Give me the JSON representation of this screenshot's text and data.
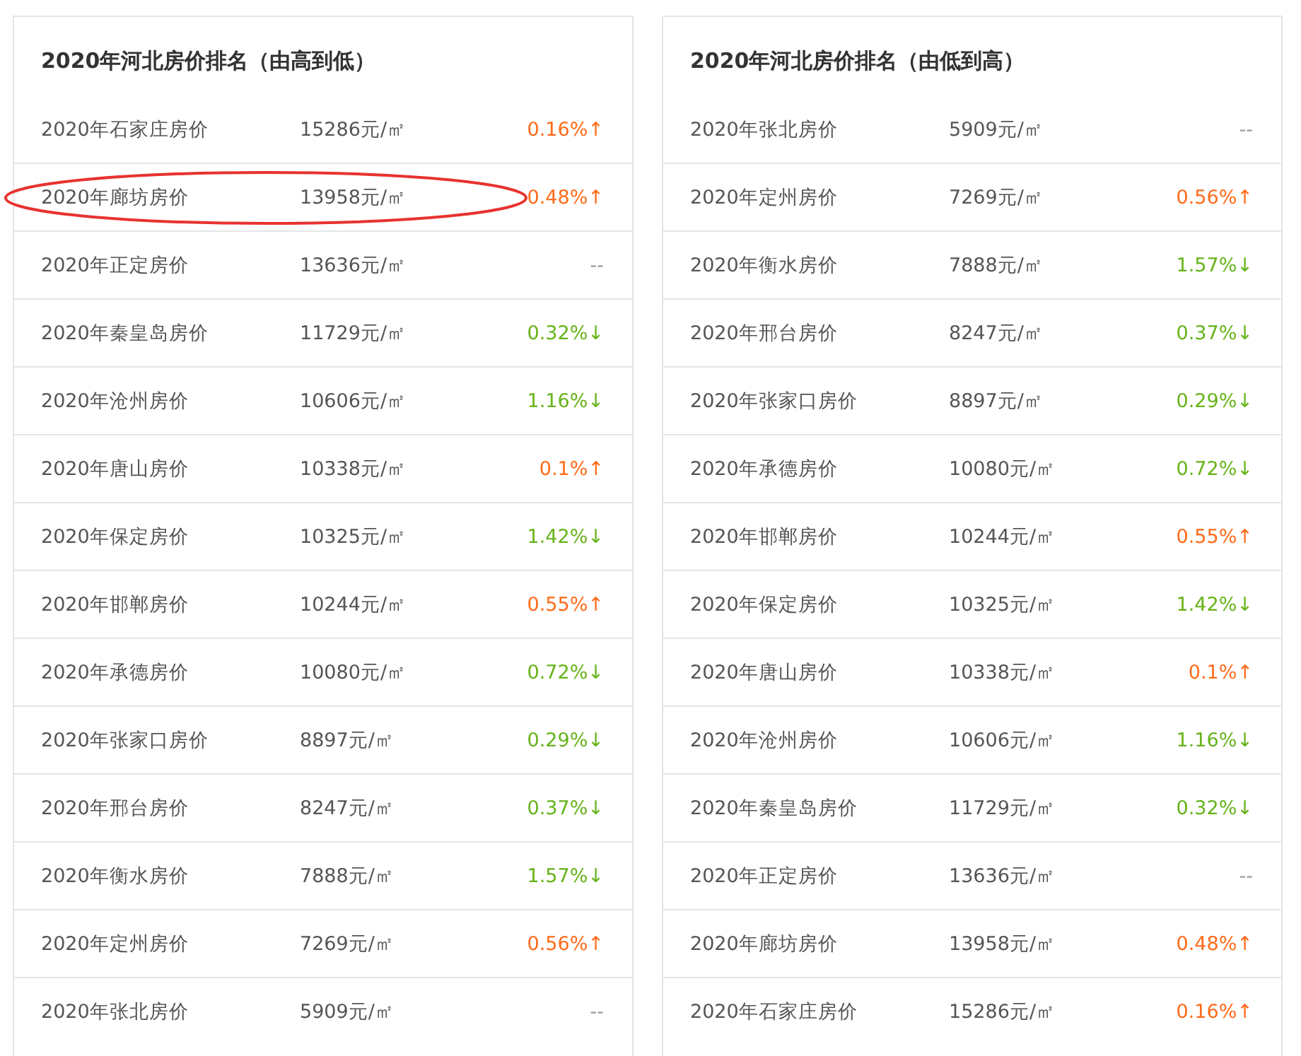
{
  "panels": [
    {
      "title": "2020年河北房价排名（由高到低）",
      "rows": [
        {
          "city": "2020年石家庄房价",
          "price": "15286元/㎡",
          "change": "0.16%↑",
          "kind": "up",
          "highlighted": false
        },
        {
          "city": "2020年廊坊房价",
          "price": "13958元/㎡",
          "change": "0.48%↑",
          "kind": "up",
          "highlighted": true
        },
        {
          "city": "2020年正定房价",
          "price": "13636元/㎡",
          "change": "--",
          "kind": "none",
          "highlighted": false
        },
        {
          "city": "2020年秦皇岛房价",
          "price": "11729元/㎡",
          "change": "0.32%↓",
          "kind": "down",
          "highlighted": false
        },
        {
          "city": "2020年沧州房价",
          "price": "10606元/㎡",
          "change": "1.16%↓",
          "kind": "down",
          "highlighted": false
        },
        {
          "city": "2020年唐山房价",
          "price": "10338元/㎡",
          "change": "0.1%↑",
          "kind": "up",
          "highlighted": false
        },
        {
          "city": "2020年保定房价",
          "price": "10325元/㎡",
          "change": "1.42%↓",
          "kind": "down",
          "highlighted": false
        },
        {
          "city": "2020年邯郸房价",
          "price": "10244元/㎡",
          "change": "0.55%↑",
          "kind": "up",
          "highlighted": false
        },
        {
          "city": "2020年承德房价",
          "price": "10080元/㎡",
          "change": "0.72%↓",
          "kind": "down",
          "highlighted": false
        },
        {
          "city": "2020年张家口房价",
          "price": "8897元/㎡",
          "change": "0.29%↓",
          "kind": "down",
          "highlighted": false
        },
        {
          "city": "2020年邢台房价",
          "price": "8247元/㎡",
          "change": "0.37%↓",
          "kind": "down",
          "highlighted": false
        },
        {
          "city": "2020年衡水房价",
          "price": "7888元/㎡",
          "change": "1.57%↓",
          "kind": "down",
          "highlighted": false
        },
        {
          "city": "2020年定州房价",
          "price": "7269元/㎡",
          "change": "0.56%↑",
          "kind": "up",
          "highlighted": false
        },
        {
          "city": "2020年张北房价",
          "price": "5909元/㎡",
          "change": "--",
          "kind": "none",
          "highlighted": false
        }
      ]
    },
    {
      "title": "2020年河北房价排名（由低到高）",
      "rows": [
        {
          "city": "2020年张北房价",
          "price": "5909元/㎡",
          "change": "--",
          "kind": "none",
          "highlighted": false
        },
        {
          "city": "2020年定州房价",
          "price": "7269元/㎡",
          "change": "0.56%↑",
          "kind": "up",
          "highlighted": false
        },
        {
          "city": "2020年衡水房价",
          "price": "7888元/㎡",
          "change": "1.57%↓",
          "kind": "down",
          "highlighted": false
        },
        {
          "city": "2020年邢台房价",
          "price": "8247元/㎡",
          "change": "0.37%↓",
          "kind": "down",
          "highlighted": false
        },
        {
          "city": "2020年张家口房价",
          "price": "8897元/㎡",
          "change": "0.29%↓",
          "kind": "down",
          "highlighted": false
        },
        {
          "city": "2020年承德房价",
          "price": "10080元/㎡",
          "change": "0.72%↓",
          "kind": "down",
          "highlighted": false
        },
        {
          "city": "2020年邯郸房价",
          "price": "10244元/㎡",
          "change": "0.55%↑",
          "kind": "up",
          "highlighted": false
        },
        {
          "city": "2020年保定房价",
          "price": "10325元/㎡",
          "change": "1.42%↓",
          "kind": "down",
          "highlighted": false
        },
        {
          "city": "2020年唐山房价",
          "price": "10338元/㎡",
          "change": "0.1%↑",
          "kind": "up",
          "highlighted": false
        },
        {
          "city": "2020年沧州房价",
          "price": "10606元/㎡",
          "change": "1.16%↓",
          "kind": "down",
          "highlighted": false
        },
        {
          "city": "2020年秦皇岛房价",
          "price": "11729元/㎡",
          "change": "0.32%↓",
          "kind": "down",
          "highlighted": false
        },
        {
          "city": "2020年正定房价",
          "price": "13636元/㎡",
          "change": "--",
          "kind": "none",
          "highlighted": false
        },
        {
          "city": "2020年廊坊房价",
          "price": "13958元/㎡",
          "change": "0.48%↑",
          "kind": "up",
          "highlighted": false
        },
        {
          "city": "2020年石家庄房价",
          "price": "15286元/㎡",
          "change": "0.16%↑",
          "kind": "up",
          "highlighted": false
        }
      ]
    }
  ]
}
